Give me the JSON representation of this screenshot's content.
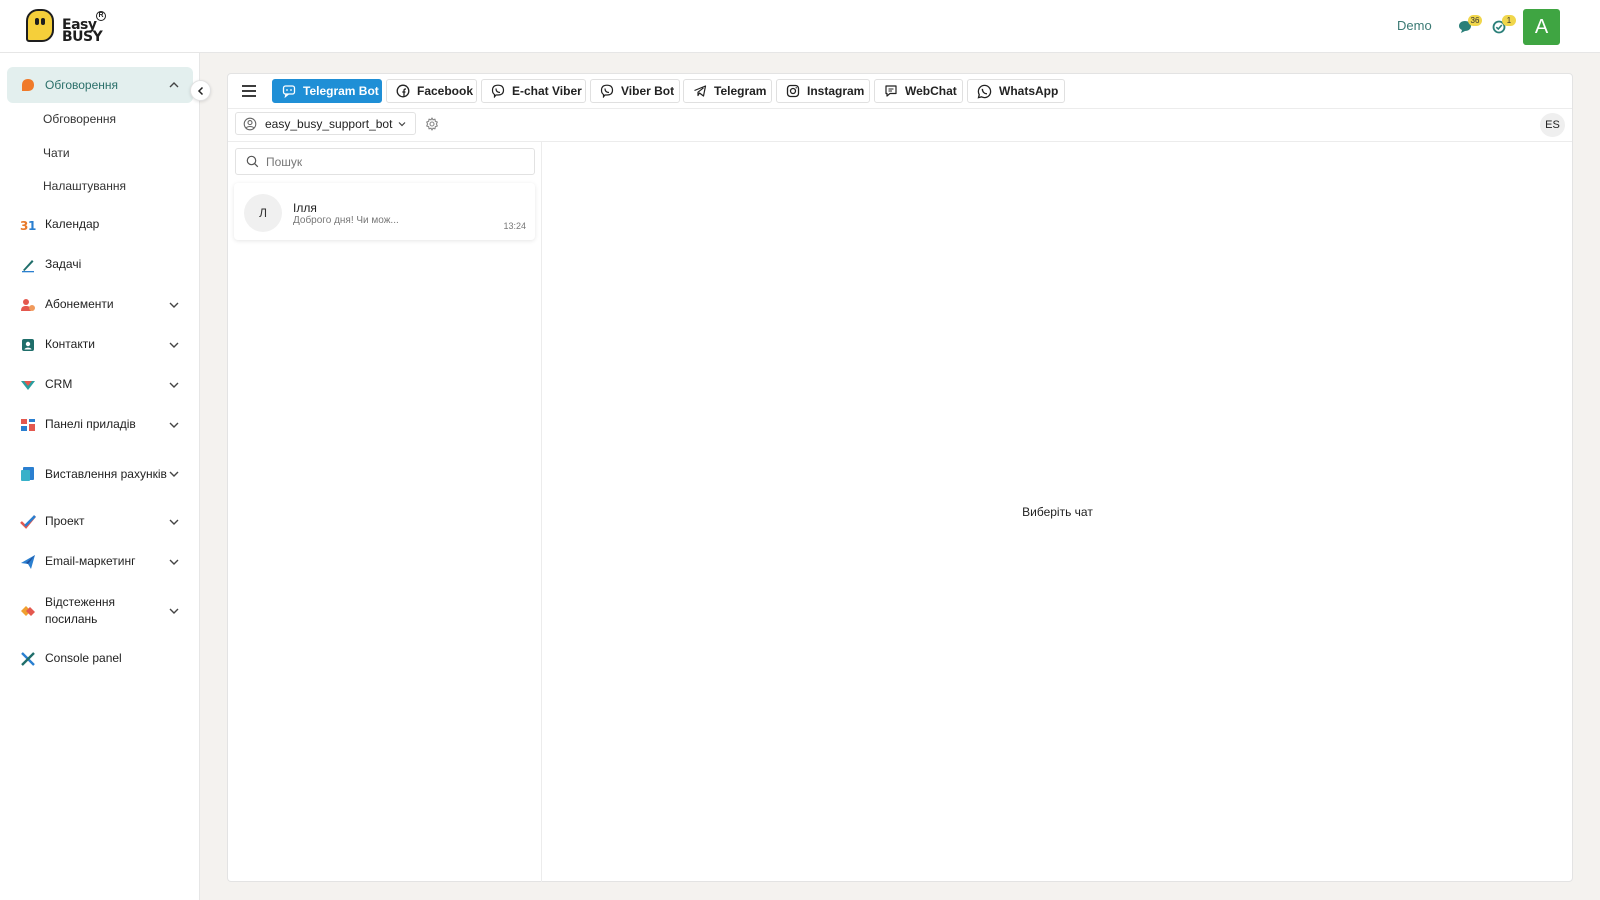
{
  "app": {
    "logo_line1": "Easy",
    "logo_line2": "BUSY",
    "logo_reg": "R"
  },
  "header": {
    "user_name": "Demo",
    "chat_count": "36",
    "task_count": "1",
    "avatar_letter": "A",
    "avatar_color": "#3fa542"
  },
  "sidebar": {
    "active_section": {
      "label": "Обговорення",
      "subitems": [
        "Обговорення",
        "Чати",
        "Налаштування"
      ]
    },
    "items": [
      {
        "label": "Календар",
        "icon": "calendar-icon"
      },
      {
        "label": "Задачі",
        "icon": "pen-icon"
      },
      {
        "label": "Абонементи",
        "icon": "subscriptions-icon"
      },
      {
        "label": "Контакти",
        "icon": "contacts-icon"
      },
      {
        "label": "CRM",
        "icon": "crm-icon"
      },
      {
        "label": "Панелі приладів",
        "icon": "dashboard-icon"
      },
      {
        "label": "Виставлення рахунків",
        "icon": "invoice-icon"
      },
      {
        "label": "Проект",
        "icon": "check-icon"
      },
      {
        "label": "Email-маркетинг",
        "icon": "send-icon"
      },
      {
        "label": "Відстеження посилань",
        "icon": "link-tracking-icon"
      },
      {
        "label": "Console panel",
        "icon": "cross-icon"
      }
    ]
  },
  "tabs": [
    {
      "label": "Telegram Bot",
      "active": true
    },
    {
      "label": "Facebook"
    },
    {
      "label": "E-chat Viber"
    },
    {
      "label": "Viber Bot"
    },
    {
      "label": "Telegram"
    },
    {
      "label": "Instagram"
    },
    {
      "label": "WebChat"
    },
    {
      "label": "WhatsApp"
    }
  ],
  "bot_selector": {
    "value": "easy_busy_support_bot"
  },
  "language": "ES",
  "search": {
    "placeholder": "Пошук"
  },
  "chats": [
    {
      "initial": "Л",
      "name": "Ілля",
      "preview": "Доброго дня! Чи мож...",
      "time": "13:24"
    }
  ],
  "empty_state": "Виберіть чат",
  "colors": {
    "accent": "#1f8fd6",
    "sidebar_active": "#e3efee",
    "brand_yellow": "#f5cf3a"
  }
}
